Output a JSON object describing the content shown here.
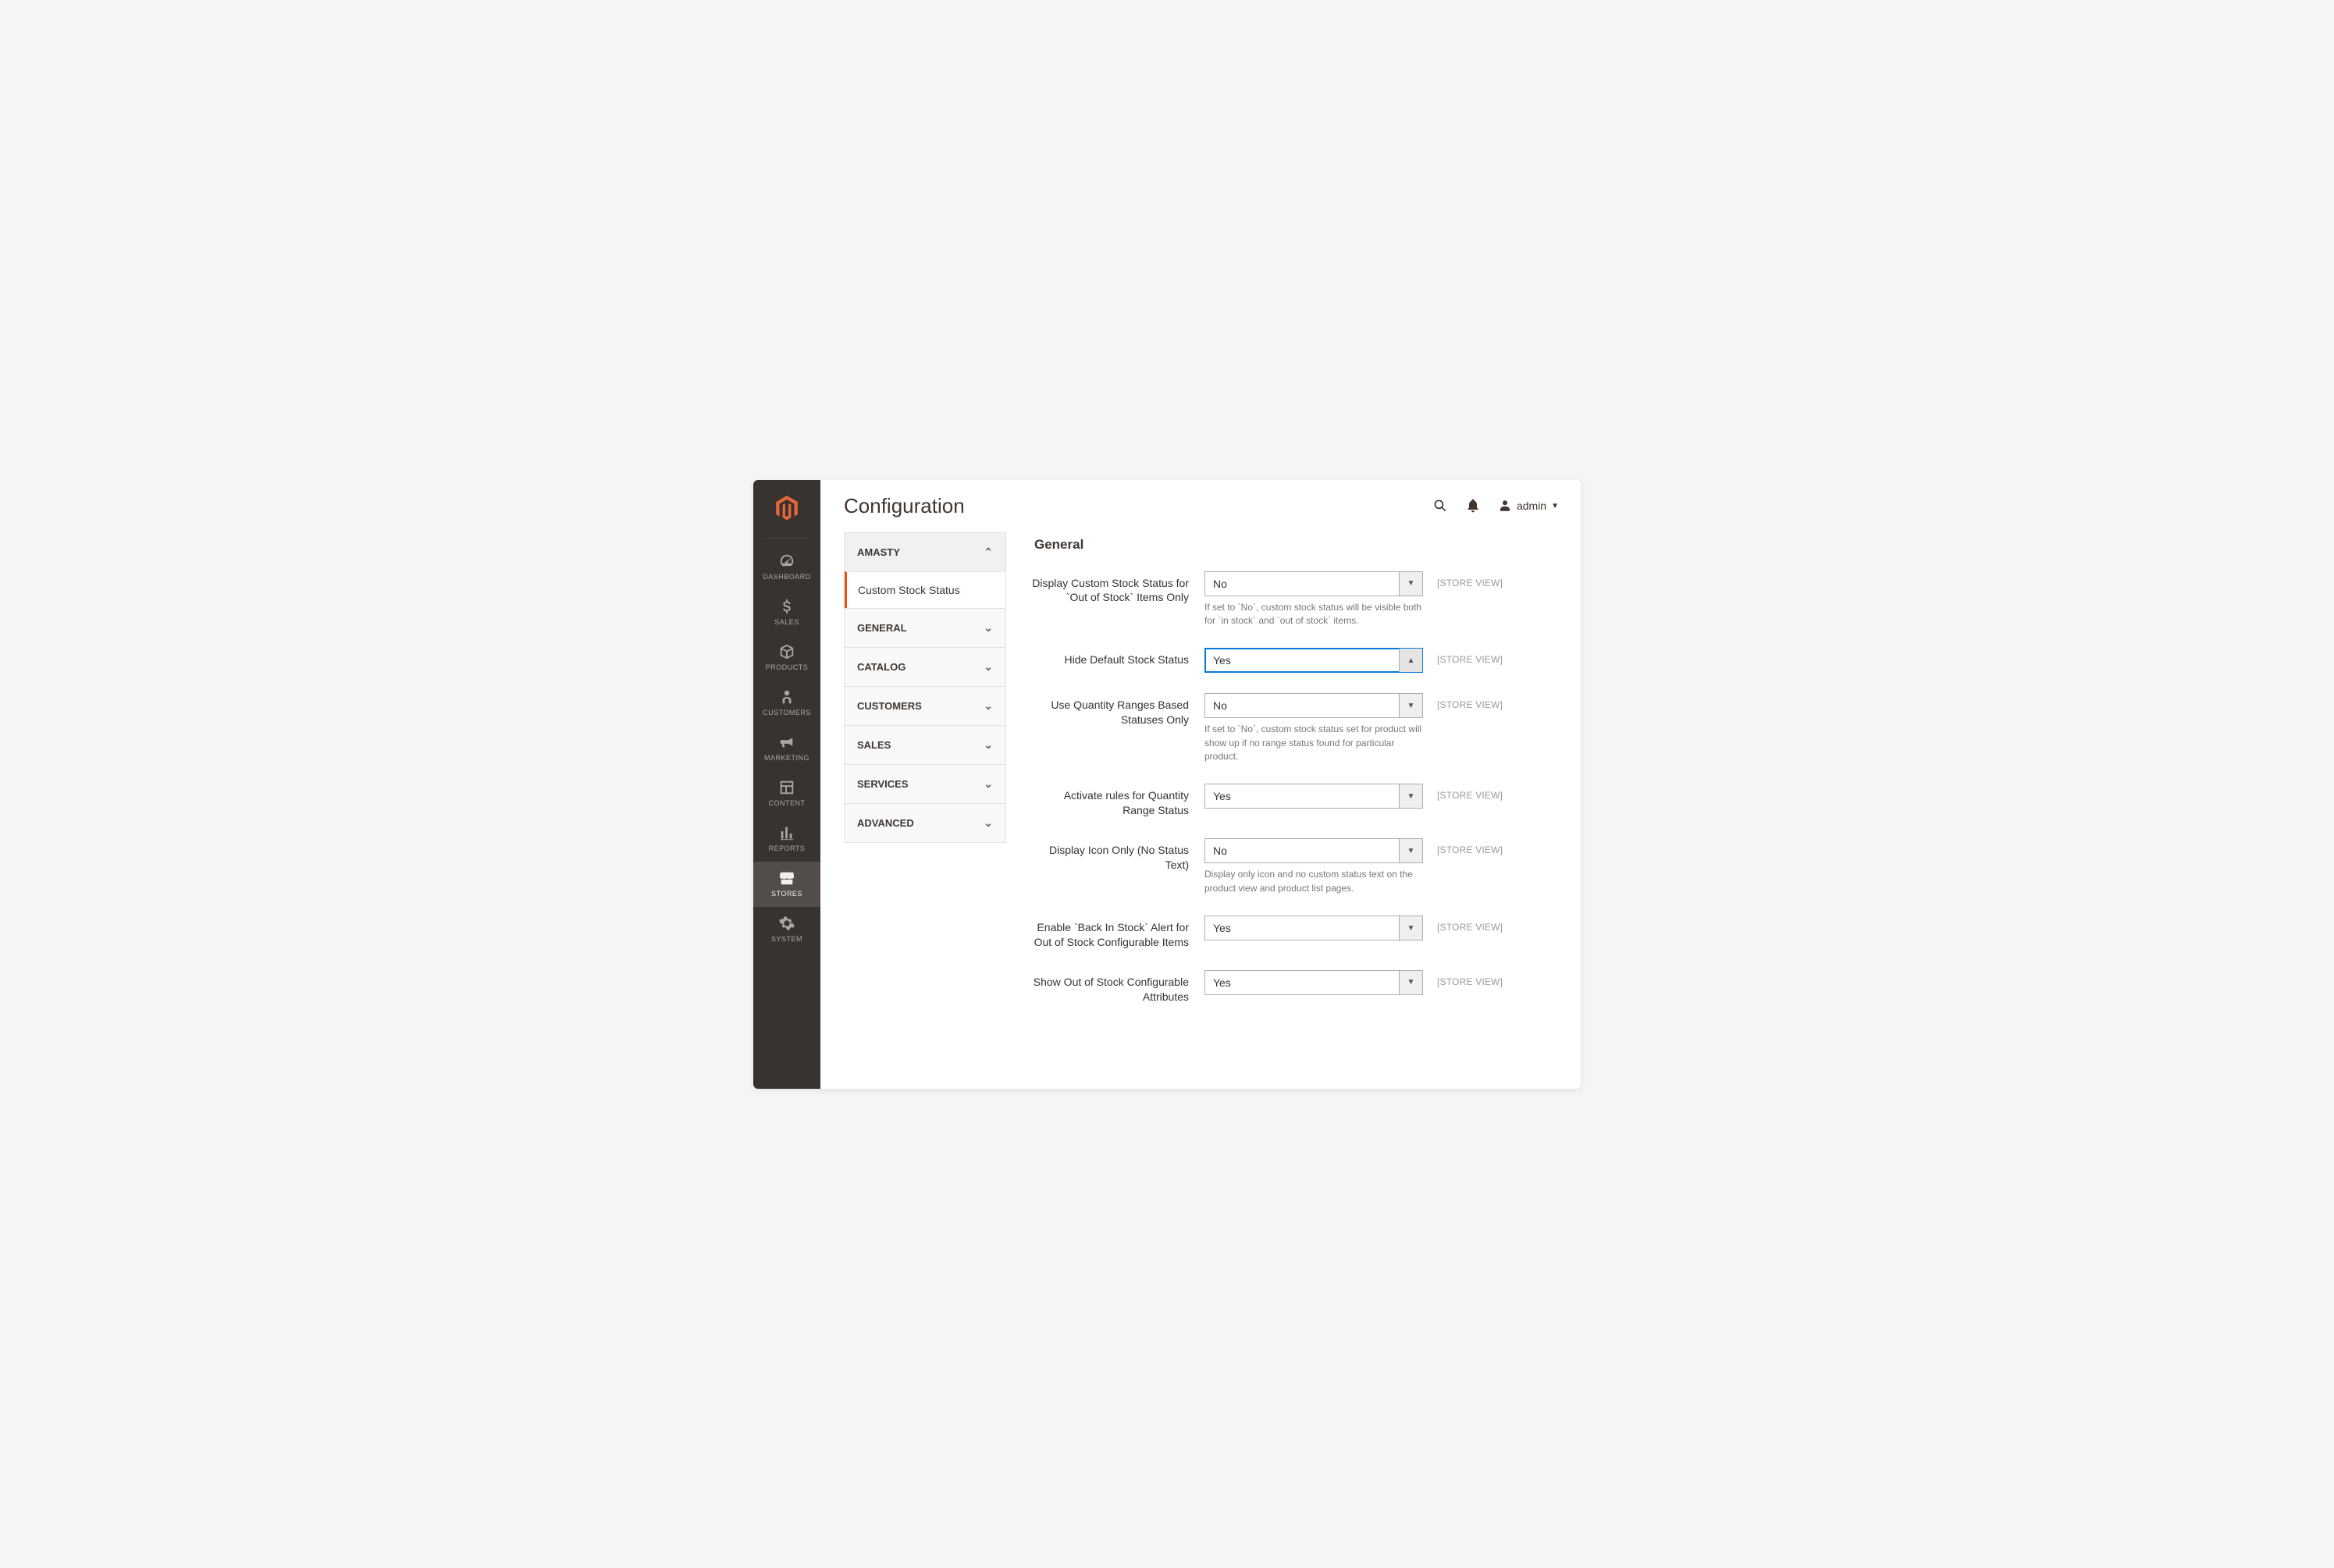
{
  "page": {
    "title": "Configuration"
  },
  "topbar": {
    "user": "admin"
  },
  "rail": {
    "items": [
      {
        "key": "dashboard",
        "label": "DASHBOARD"
      },
      {
        "key": "sales",
        "label": "SALES"
      },
      {
        "key": "products",
        "label": "PRODUCTS"
      },
      {
        "key": "customers",
        "label": "CUSTOMERS"
      },
      {
        "key": "marketing",
        "label": "MARKETING"
      },
      {
        "key": "content",
        "label": "CONTENT"
      },
      {
        "key": "reports",
        "label": "REPORTS"
      },
      {
        "key": "stores",
        "label": "STORES"
      },
      {
        "key": "system",
        "label": "SYSTEM"
      }
    ]
  },
  "config_nav": {
    "groups": [
      {
        "label": "AMASTY",
        "expanded": true,
        "items": [
          {
            "label": "Custom Stock Status",
            "active": true
          }
        ]
      },
      {
        "label": "GENERAL",
        "expanded": false
      },
      {
        "label": "CATALOG",
        "expanded": false
      },
      {
        "label": "CUSTOMERS",
        "expanded": false
      },
      {
        "label": "SALES",
        "expanded": false
      },
      {
        "label": "SERVICES",
        "expanded": false
      },
      {
        "label": "ADVANCED",
        "expanded": false
      }
    ]
  },
  "section": {
    "title": "General",
    "scope_label": "[STORE VIEW]"
  },
  "fields": [
    {
      "label": "Display Custom Stock Status for `Out of Stock` Items Only",
      "value": "No",
      "help": "If set to `No`, custom stock status will be visible both for `in stock` and `out of stock` items.",
      "focused": false
    },
    {
      "label": "Hide Default Stock Status",
      "value": "Yes",
      "help": "",
      "focused": true
    },
    {
      "label": "Use Quantity Ranges Based Statuses Only",
      "value": "No",
      "help": "If set to `No`, custom stock status set for product will show up if no range status found for particular product.",
      "focused": false
    },
    {
      "label": "Activate rules for Quantity Range Status",
      "value": "Yes",
      "help": "",
      "focused": false
    },
    {
      "label": "Display Icon Only (No Status Text)",
      "value": "No",
      "help": "Display only icon and no custom status text on the product view and product list pages.",
      "focused": false
    },
    {
      "label": "Enable `Back In Stock` Alert for Out of Stock Configurable Items",
      "value": "Yes",
      "help": "",
      "focused": false
    },
    {
      "label": "Show Out of Stock Configurable Attributes",
      "value": "Yes",
      "help": "",
      "focused": false
    }
  ]
}
